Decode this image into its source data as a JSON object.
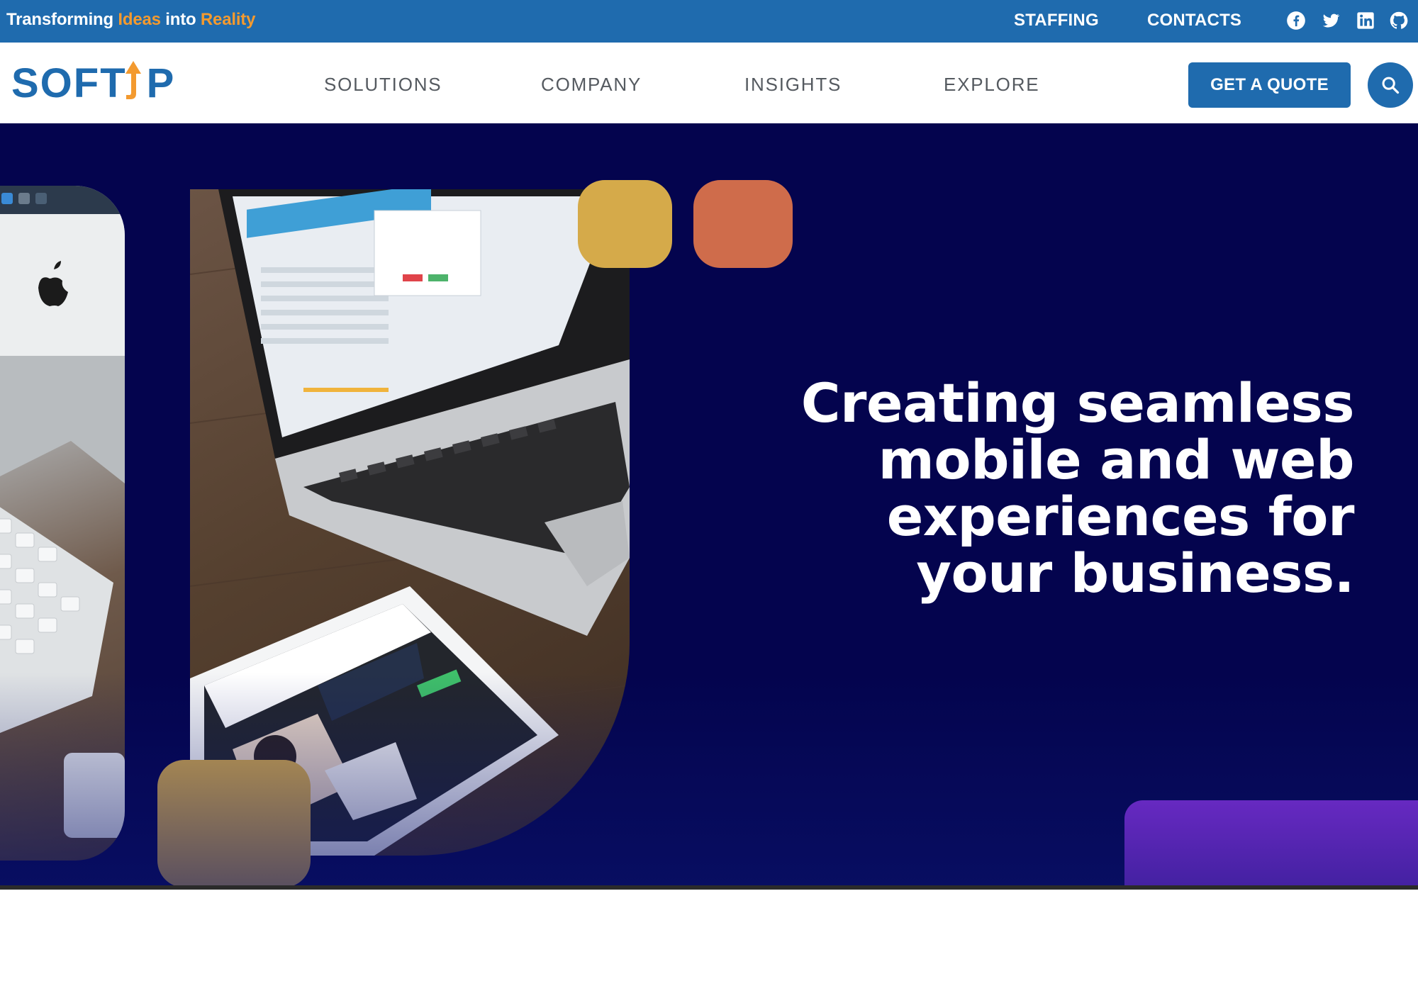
{
  "topbar": {
    "tagline_part1": "Transforming ",
    "tagline_hl1": "Ideas",
    "tagline_part2": " into ",
    "tagline_hl2": "Reality",
    "staffing": "STAFFING",
    "contacts": "CONTACTS",
    "socials": [
      "facebook-icon",
      "twitter-icon",
      "linkedin-icon",
      "github-icon"
    ]
  },
  "header": {
    "logo_text": "SOFT",
    "logo_end": "P",
    "nav": [
      "SOLUTIONS",
      "COMPANY",
      "INSIGHTS",
      "EXPLORE"
    ],
    "quote_button": "GET A QUOTE",
    "search_icon": "search-icon"
  },
  "hero": {
    "headline": "Creating seamless mobile and web experiences for your business."
  },
  "colors": {
    "brand_blue": "#1f6bae",
    "accent_orange": "#f39a2f",
    "hero_bg": "#04044e",
    "gold": "#d5aa4a",
    "coral": "#cf6c4b",
    "purple": "#9b35f0"
  }
}
